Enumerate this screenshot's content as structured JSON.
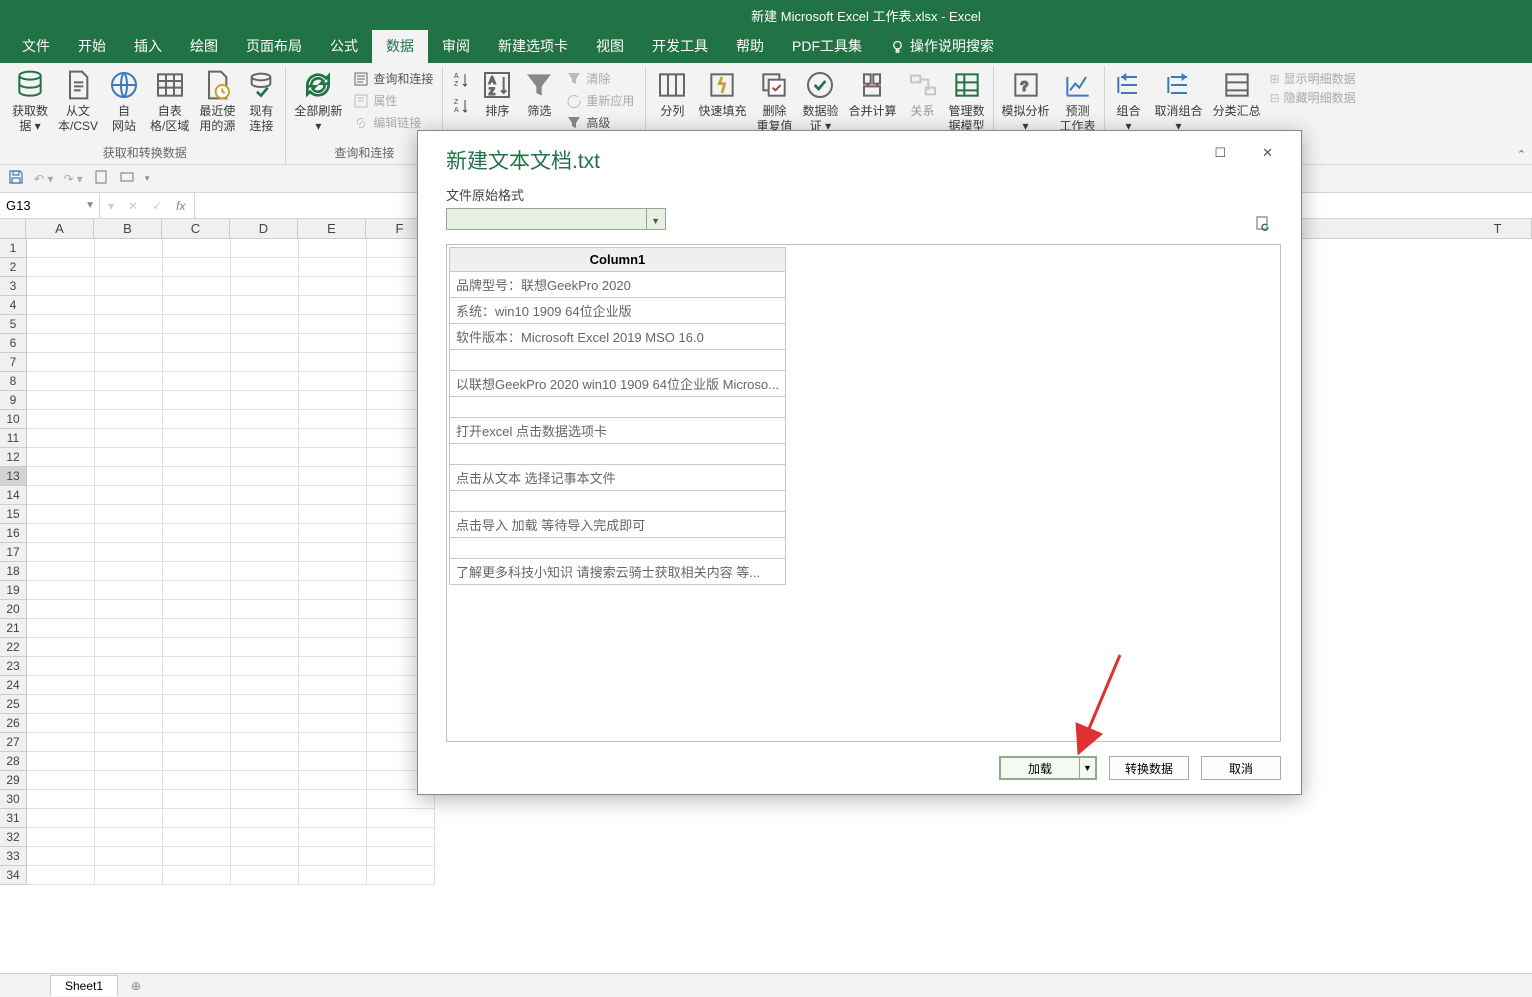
{
  "title": "新建 Microsoft Excel 工作表.xlsx  -  Excel",
  "ribbon_tabs": [
    "文件",
    "开始",
    "插入",
    "绘图",
    "页面布局",
    "公式",
    "数据",
    "审阅",
    "新建选项卡",
    "视图",
    "开发工具",
    "帮助",
    "PDF工具集"
  ],
  "ribbon_search": "操作说明搜索",
  "active_tab_index": 6,
  "ribbon": {
    "group1": {
      "btns": [
        "获取数\n据 ▾",
        "从文\n本/CSV",
        "自\n网站",
        "自表\n格/区域",
        "最近使\n用的源",
        "现有\n连接"
      ],
      "label": "获取和转换数据"
    },
    "group2": {
      "btn": "全部刷新\n▾",
      "items": [
        "查询和连接",
        "属性",
        "编辑链接"
      ],
      "label": "查询和连接"
    },
    "group3": {
      "sort_az": "A↓Z",
      "sort": "排序",
      "filter": "筛选",
      "items": [
        "清除",
        "重新应用",
        "高级"
      ]
    },
    "group4": {
      "btns": [
        "分列",
        "快速填充",
        "删除\n重复值",
        "数据验\n证 ▾",
        "合并计算",
        "关系",
        "管理数\n据模型"
      ]
    },
    "group5": {
      "btns": [
        "模拟分析\n▾",
        "预测\n工作表"
      ]
    },
    "group6": {
      "btns": [
        "组合\n▾",
        "取消组合\n▾",
        "分类汇总"
      ],
      "outline": [
        "显示明细数据",
        "隐藏明细数据"
      ]
    }
  },
  "cell_ref": "G13",
  "col_headers": [
    "A",
    "B",
    "C",
    "D",
    "E",
    "F"
  ],
  "col_headers_right": [
    "T"
  ],
  "row_count": 34,
  "selected_row": 13,
  "dialog": {
    "title": "新建文本文档.txt",
    "field_label": "文件原始格式",
    "table_header": "Column1",
    "rows": [
      "品牌型号：联想GeekPro 2020",
      "系统：win10 1909 64位企业版",
      "软件版本：Microsoft Excel 2019 MSO 16.0",
      "",
      "以联想GeekPro 2020 win10 1909 64位企业版 Microso...",
      "",
      "打开excel 点击数据选项卡",
      "",
      "点击从文本 选择记事本文件",
      "",
      "点击导入 加载 等待导入完成即可",
      "",
      "了解更多科技小知识 请搜索云骑士获取相关内容 等..."
    ],
    "buttons": {
      "load": "加载",
      "transform": "转换数据",
      "cancel": "取消"
    }
  },
  "sheet_tab": "Sheet1"
}
